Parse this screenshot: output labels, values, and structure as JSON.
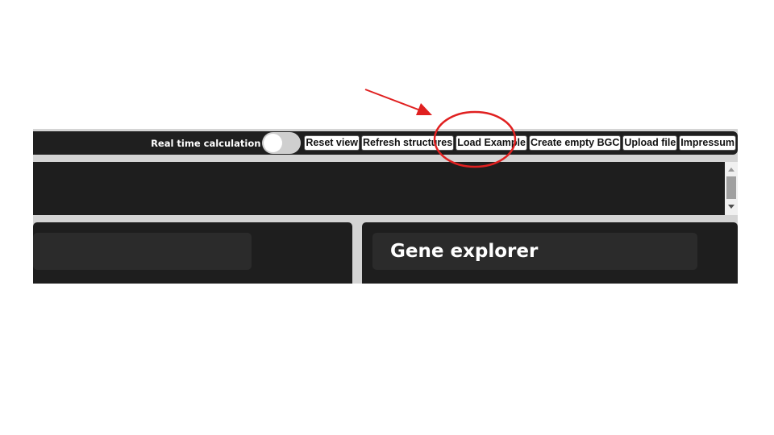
{
  "toolbar": {
    "realtime_label": "Real time calculation",
    "buttons": [
      {
        "label": "Reset view"
      },
      {
        "label": "Refresh structures"
      },
      {
        "label": "Load Example"
      },
      {
        "label": "Create empty BGC"
      },
      {
        "label": "Upload file"
      },
      {
        "label": "Impressum"
      }
    ]
  },
  "panels": {
    "gene_explorer_title": "Gene explorer"
  },
  "annotation": {
    "highlight_color": "#e02020",
    "highlighted_button": "Load Example"
  },
  "colors": {
    "toolbar_bg": "#1f1f1f",
    "panel_bg": "#1e1e1e",
    "panel_header_bg": "#2b2b2b",
    "page_bg": "#ffffff"
  }
}
